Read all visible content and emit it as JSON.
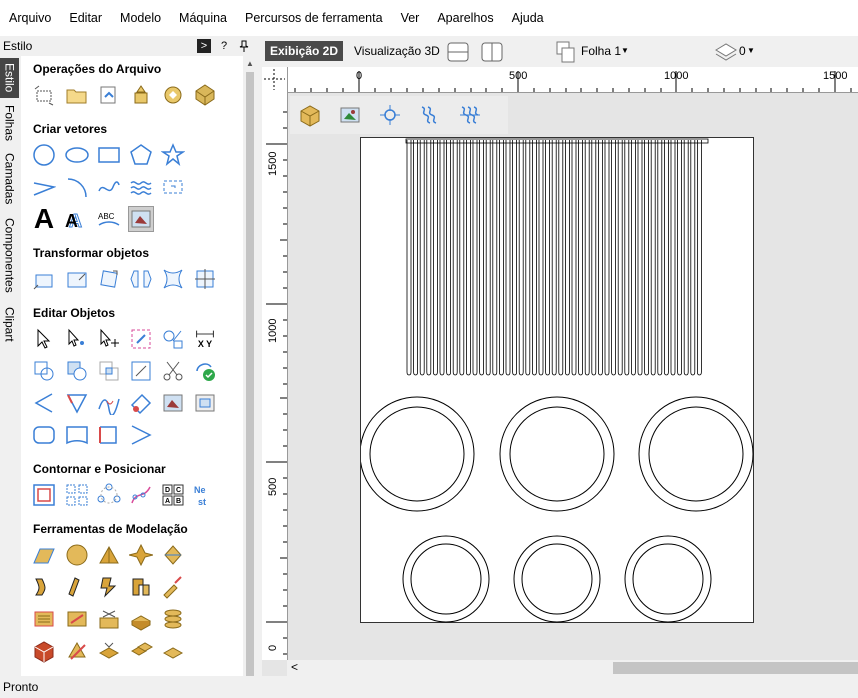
{
  "menu": [
    "Arquivo",
    "Editar",
    "Modelo",
    "Máquina",
    "Percursos de ferramenta",
    "Ver",
    "Aparelhos",
    "Ajuda"
  ],
  "panel": {
    "title": "Estilo",
    "help": "?",
    "vertical_tabs": [
      "Estilo",
      "Folhas",
      "Camadas",
      "Componentes",
      "Clipart"
    ],
    "sections": [
      "Operações do Arquivo",
      "Criar vetores",
      "Transformar objetos",
      "Editar Objetos",
      "Contornar e Posicionar",
      "Ferramentas de Modelação"
    ],
    "text_tool_labels": {
      "big_a": "A",
      "abc": "ABC",
      "xy": "X Y",
      "dc_ab": "DC AB"
    }
  },
  "toolbar": {
    "tab_2d": "Exibição 2D",
    "tab_3d": "Visualização 3D",
    "sheet_label": "Folha 1",
    "layer_count": "0"
  },
  "rulers": {
    "h_labels": [
      "0",
      "500",
      "1000",
      "1500"
    ],
    "v_labels": [
      "1500",
      "1000",
      "500",
      "0"
    ]
  },
  "status": "Pronto",
  "colors": {
    "accent_blue": "#3a7fd6",
    "active_tab": "#4a4a4a",
    "gold": "#d9a43a"
  }
}
